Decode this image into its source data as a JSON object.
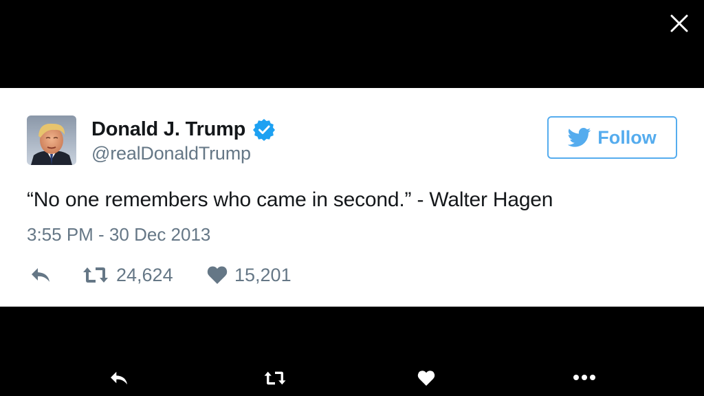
{
  "viewer": {
    "close_icon": "close-icon"
  },
  "tweet": {
    "display_name": "Donald J. Trump",
    "handle": "@realDonaldTrump",
    "verified_icon": "verified-badge-icon",
    "follow_label": "Follow",
    "follow_icon": "twitter-bird-icon",
    "text": "“No one remembers who came in second.” - Walter Hagen",
    "timestamp": "3:55 PM - 30 Dec 2013",
    "actions": {
      "reply_icon": "reply-icon",
      "retweet_icon": "retweet-icon",
      "retweet_count": "24,624",
      "like_icon": "heart-icon",
      "like_count": "15,201"
    }
  },
  "bottom_bar": {
    "icons": [
      "reply-icon",
      "retweet-icon",
      "heart-icon",
      "more-icon"
    ]
  },
  "colors": {
    "background": "#000000",
    "card": "#ffffff",
    "text": "#14171a",
    "secondary": "#657786",
    "accent": "#55acee",
    "verified": "#1da1f2"
  }
}
